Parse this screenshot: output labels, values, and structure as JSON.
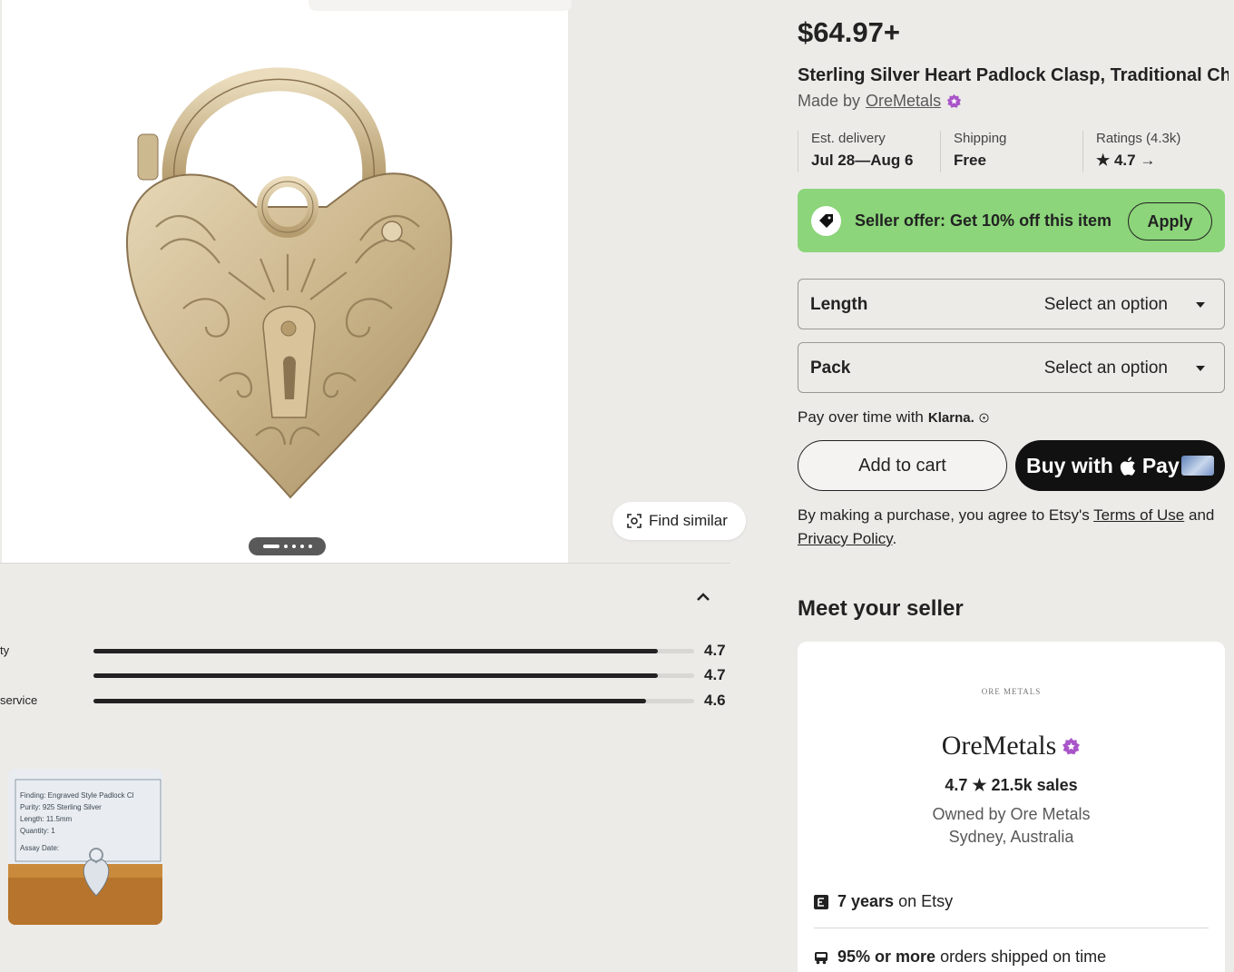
{
  "gallery": {
    "find_similar_label": "Find similar"
  },
  "ratings": {
    "rows": [
      {
        "label": "ty",
        "value": "4.7",
        "fraction": 0.94
      },
      {
        "label": "",
        "value": "4.7",
        "fraction": 0.94
      },
      {
        "label": " service",
        "value": "4.6",
        "fraction": 0.92
      }
    ]
  },
  "thumbnail": {
    "lines": [
      "Finding: Engraved Style Padlock Cl",
      "Purity: 925 Sterling Silver",
      "Length: 11.5mm",
      "Quantity: 1",
      "Assay Date:"
    ]
  },
  "listing": {
    "price": "$64.97+",
    "title": "Sterling Silver Heart Padlock Clasp, Traditional Ch...",
    "made_by_prefix": "Made by",
    "shop_name": "OreMetals"
  },
  "info": {
    "delivery_label": "Est. delivery",
    "delivery_value": "Jul 28—Aug 6",
    "shipping_label": "Shipping",
    "shipping_value": "Free",
    "ratings_label": "Ratings (4.3k)",
    "ratings_value": "★ 4.7 →"
  },
  "offer": {
    "text": "Seller offer: Get 10% off this item",
    "apply_label": "Apply"
  },
  "options": {
    "length_label": "Length",
    "length_value": "Select an option",
    "pack_label": "Pack",
    "pack_value": "Select an option"
  },
  "purchase": {
    "klarna_prefix": "Pay over time with",
    "klarna_brand": "Klarna.",
    "add_to_cart": "Add to cart",
    "buy_with": "Buy with",
    "apple_pay": "Pay",
    "legal_prefix": "By making a purchase, you agree to Etsy's",
    "terms": "Terms of Use",
    "and": "and",
    "privacy": "Privacy Policy",
    "period": "."
  },
  "seller": {
    "heading": "Meet your seller",
    "logo_text": "ORE METALS",
    "shop_name": "OreMetals",
    "stats": "4.7 ★ 21.5k sales",
    "owner": "Owned by Ore Metals",
    "location": "Sydney, Australia",
    "years_bold": "7 years",
    "years_rest": "on Etsy",
    "ontime_bold": "95% or more",
    "ontime_rest": "orders shipped on time"
  },
  "colors": {
    "background": "#ecebe8",
    "offer_green": "#8cd57a",
    "star_badge": "#a855c8",
    "apple_pay_bg": "#111111"
  }
}
